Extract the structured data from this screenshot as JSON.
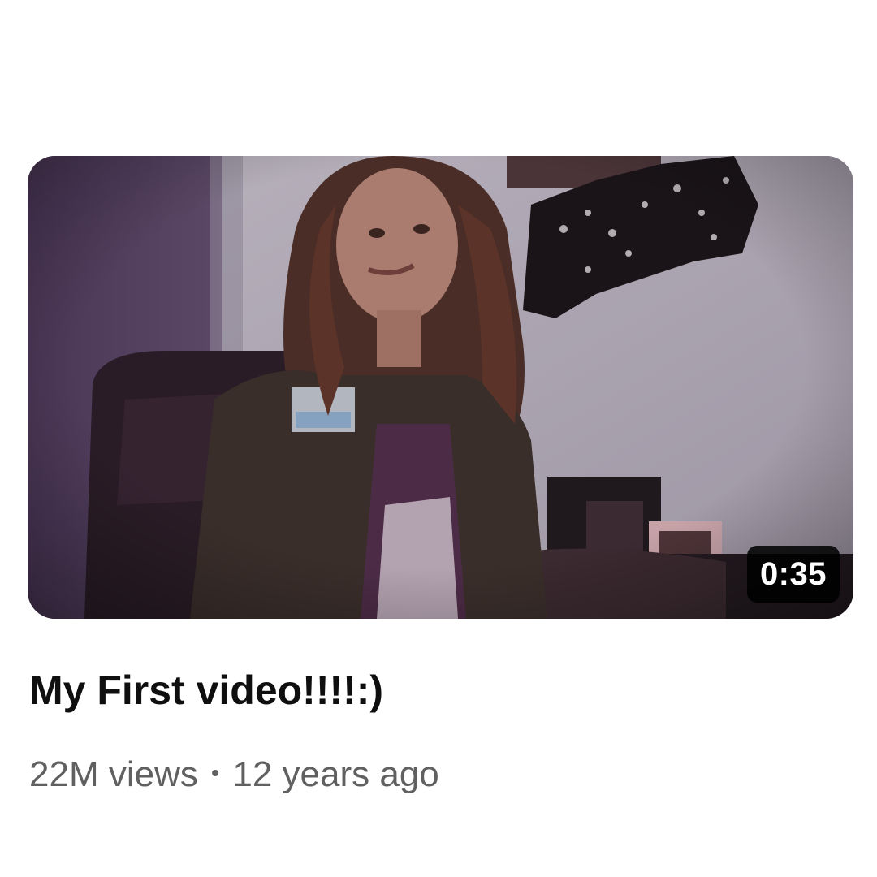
{
  "video": {
    "duration": "0:35",
    "title": "My First video!!!!:)",
    "views": "22M views",
    "separator": "•",
    "age": "12 years ago"
  }
}
